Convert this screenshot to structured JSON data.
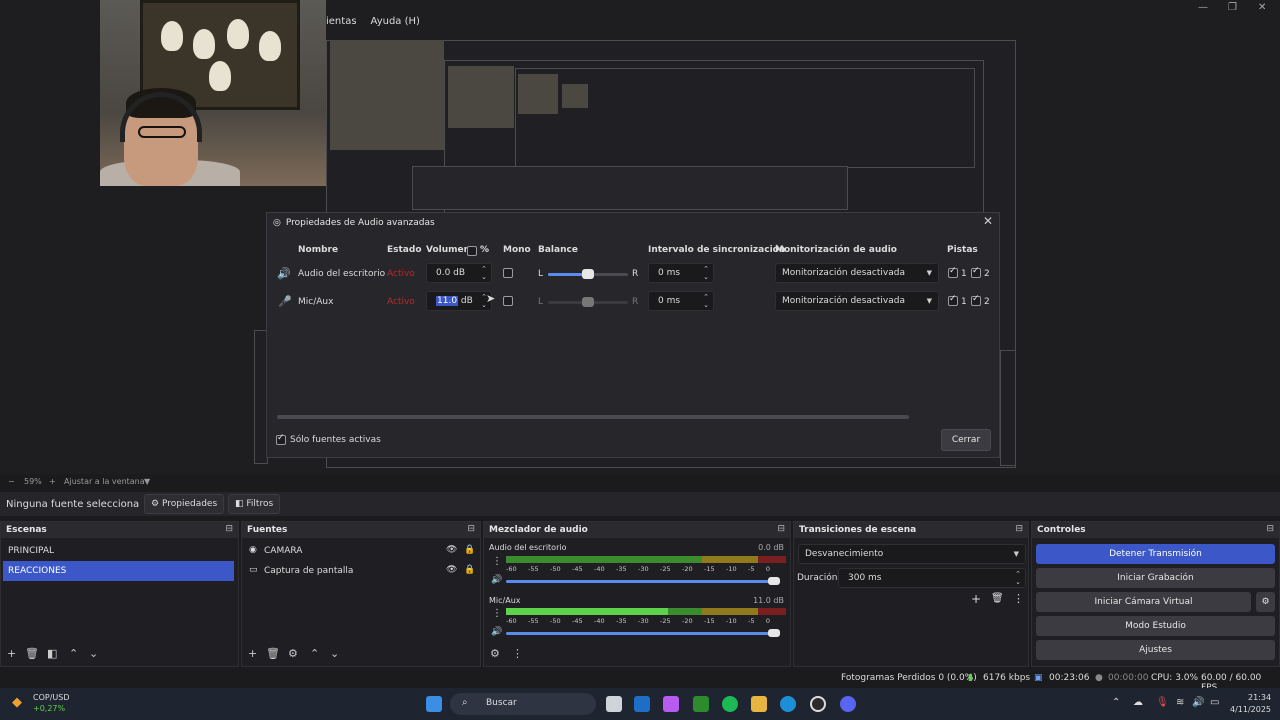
{
  "menubar": {
    "items": [
      "ientas",
      "Ayuda (H)"
    ]
  },
  "dialog": {
    "title": "Propiedades de Audio avanzadas",
    "close": "✕",
    "headers": {
      "name": "Nombre",
      "status": "Estado",
      "volume": "Volumen",
      "percent": "%",
      "mono": "Mono",
      "balance": "Balance",
      "sync": "Intervalo de sincronización",
      "monitoring": "Monitorización de audio",
      "tracks": "Pistas"
    },
    "rows": [
      {
        "name": "Audio del escritorio",
        "status": "Activo",
        "volume": "0.0 dB",
        "balance_l": "L",
        "balance_r": "R",
        "sync": "0 ms",
        "monitoring": "Monitorización desactivada",
        "track1": "1",
        "track2": "2",
        "balance_pos": 0.5
      },
      {
        "name": "Mic/Aux",
        "status": "Activo",
        "volume": "11.0",
        "volume_unit": "dB",
        "balance_l": "L",
        "balance_r": "R",
        "sync": "0 ms",
        "monitoring": "Monitorización desactivada",
        "track1": "1",
        "track2": "2",
        "balance_pos": 0.5
      }
    ],
    "active_only_label": "Sólo fuentes activas",
    "close_button": "Cerrar"
  },
  "zoombar": {
    "minus": "−",
    "zoom": "59%",
    "plus": "+",
    "fit": "Ajustar a la ventana"
  },
  "sourcebar": {
    "label": "Ninguna fuente selecciona",
    "properties": "Propiedades",
    "filters": "Filtros"
  },
  "scenes": {
    "title": "Escenas",
    "items": [
      "PRINCIPAL",
      "REACCIONES"
    ]
  },
  "sources": {
    "title": "Fuentes",
    "items": [
      "CAMARA",
      "Captura de pantalla"
    ]
  },
  "mixer": {
    "title": "Mezclador de audio",
    "channels": [
      {
        "name": "Audio del escritorio",
        "db": "0.0 dB",
        "level": 0.0
      },
      {
        "name": "Mic/Aux",
        "db": "11.0 dB",
        "level": 0.58
      }
    ],
    "scale": [
      "-60",
      "-55",
      "-50",
      "-45",
      "-40",
      "-35",
      "-30",
      "-25",
      "-20",
      "-15",
      "-10",
      "-5",
      "0"
    ]
  },
  "transitions": {
    "title": "Transiciones de escena",
    "selected": "Desvanecimiento",
    "duration_label": "Duración",
    "duration": "300 ms"
  },
  "controls": {
    "title": "Controles",
    "buttons": [
      "Detener Transmisión",
      "Iniciar Grabación",
      "Iniciar Cámara Virtual",
      "Modo Estudio",
      "Ajustes"
    ]
  },
  "status": {
    "dropped": "Fotogramas Perdidos 0 (0.0%)",
    "bitrate": "6176 kbps",
    "live": "00:23:06",
    "rec": "00:00:00",
    "cpu": "CPU: 3.0%",
    "fps": "60.00 / 60.00 FPS"
  },
  "taskbar": {
    "ticker": "COP/USD",
    "change": "+0,27%",
    "search": "Buscar",
    "time": "21:34",
    "date": "4/11/2025"
  },
  "colors": {
    "accent": "#3b57c8",
    "status_active": "#b52a2a",
    "meter_green": "#5ed24a"
  }
}
